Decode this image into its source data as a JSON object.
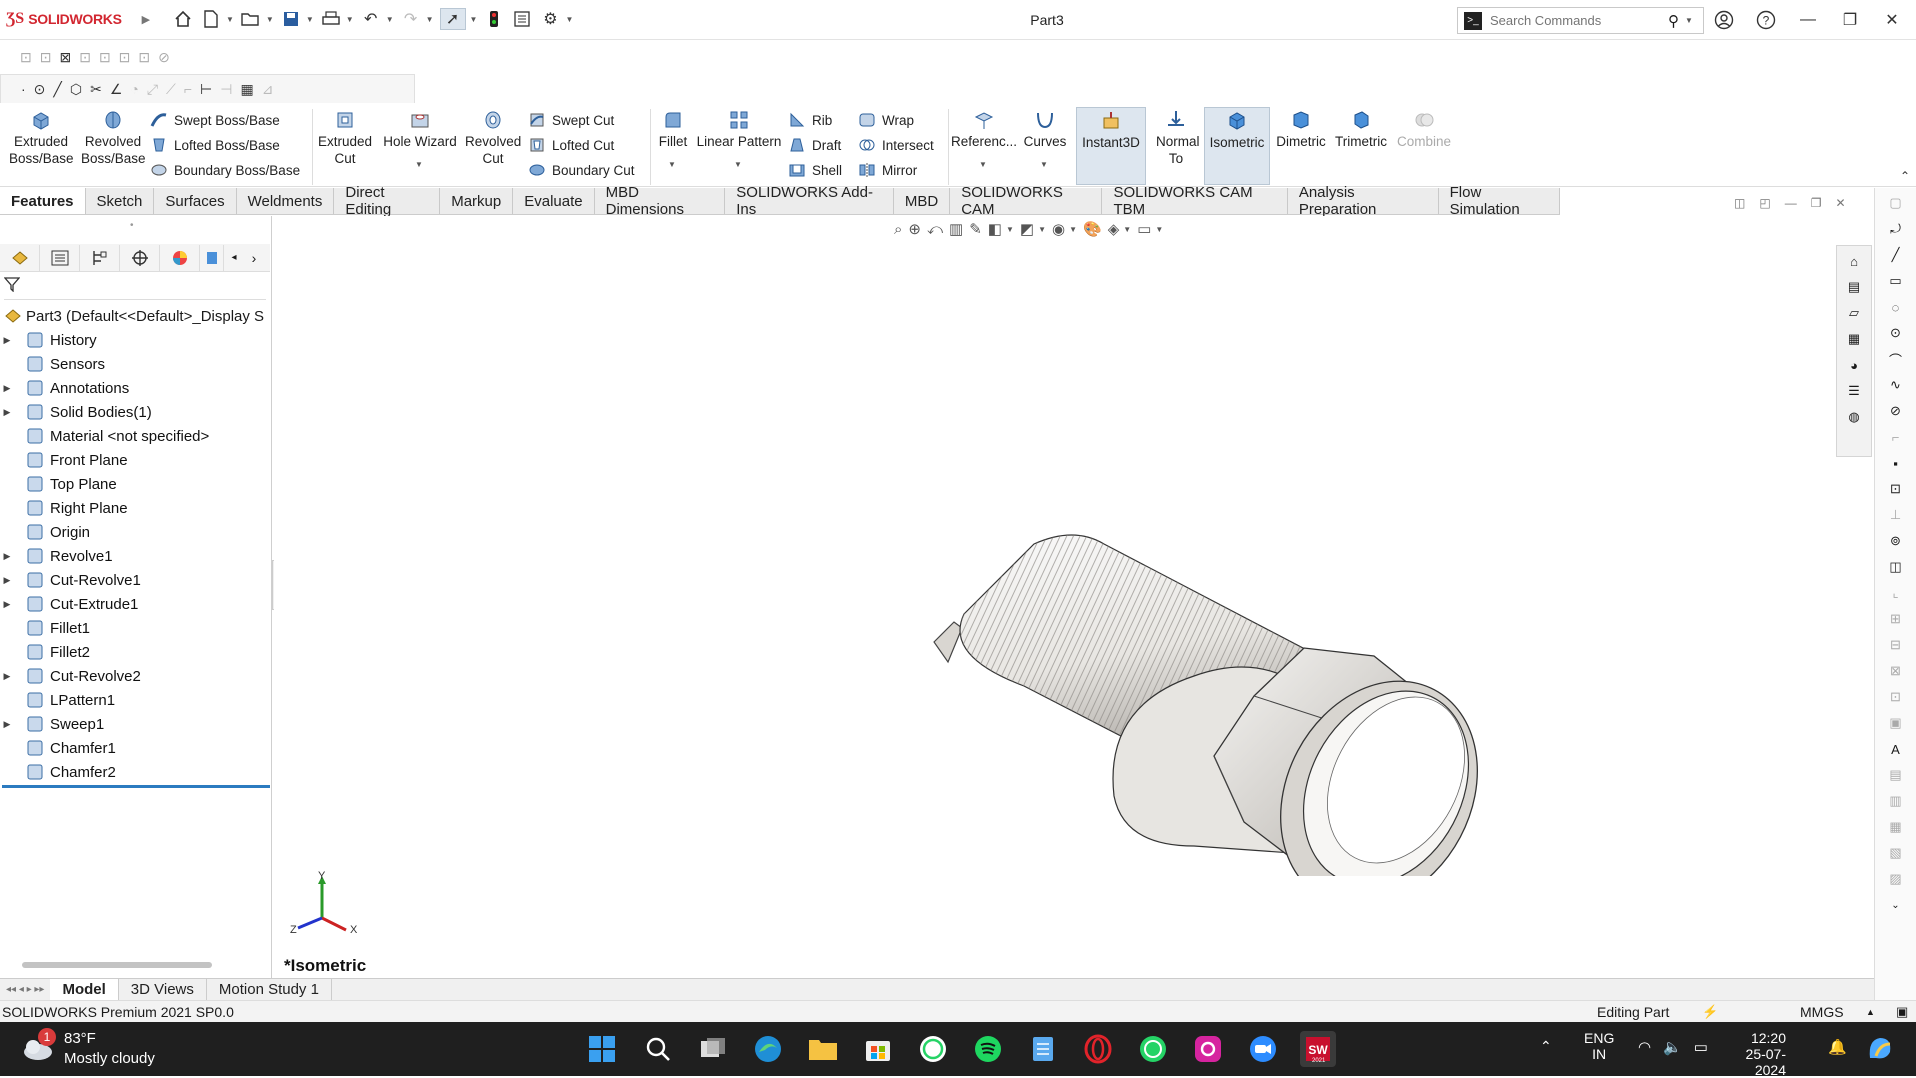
{
  "app": {
    "name": "SOLIDWORKS",
    "doc_title": "Part3"
  },
  "search": {
    "placeholder": "Search Commands"
  },
  "command_manager": {
    "extruded_boss": "Extruded Boss/Base",
    "revolved_boss": "Revolved Boss/Base",
    "swept_boss": "Swept Boss/Base",
    "lofted_boss": "Lofted Boss/Base",
    "boundary_boss": "Boundary Boss/Base",
    "extruded_cut": "Extruded Cut",
    "hole_wizard": "Hole Wizard",
    "revolved_cut": "Revolved Cut",
    "swept_cut": "Swept Cut",
    "lofted_cut": "Lofted Cut",
    "boundary_cut": "Boundary Cut",
    "fillet": "Fillet",
    "linear_pattern": "Linear Pattern",
    "rib": "Rib",
    "draft": "Draft",
    "shell": "Shell",
    "wrap": "Wrap",
    "intersect": "Intersect",
    "mirror": "Mirror",
    "reference": "Referenc...",
    "curves": "Curves",
    "instant3d": "Instant3D",
    "normal_to": "Normal To",
    "isometric": "Isometric",
    "dimetric": "Dimetric",
    "trimetric": "Trimetric",
    "combine": "Combine"
  },
  "tabs": [
    "Features",
    "Sketch",
    "Surfaces",
    "Weldments",
    "Direct Editing",
    "Markup",
    "Evaluate",
    "MBD Dimensions",
    "SOLIDWORKS Add-Ins",
    "MBD",
    "SOLIDWORKS CAM",
    "SOLIDWORKS CAM TBM",
    "Analysis Preparation",
    "Flow Simulation"
  ],
  "tree": {
    "root": "Part3  (Default<<Default>_Display S",
    "items": [
      {
        "label": "History",
        "icon": "history-icon",
        "expandable": true
      },
      {
        "label": "Sensors",
        "icon": "sensors-icon",
        "expandable": false
      },
      {
        "label": "Annotations",
        "icon": "annotations-icon",
        "expandable": true
      },
      {
        "label": "Solid Bodies(1)",
        "icon": "solid-bodies-icon",
        "expandable": true
      },
      {
        "label": "Material <not specified>",
        "icon": "material-icon",
        "expandable": false
      },
      {
        "label": "Front Plane",
        "icon": "plane-icon",
        "expandable": false
      },
      {
        "label": "Top Plane",
        "icon": "plane-icon",
        "expandable": false
      },
      {
        "label": "Right Plane",
        "icon": "plane-icon",
        "expandable": false
      },
      {
        "label": "Origin",
        "icon": "origin-icon",
        "expandable": false
      },
      {
        "label": "Revolve1",
        "icon": "revolve-icon",
        "expandable": true
      },
      {
        "label": "Cut-Revolve1",
        "icon": "cut-revolve-icon",
        "expandable": true
      },
      {
        "label": "Cut-Extrude1",
        "icon": "cut-extrude-icon",
        "expandable": true
      },
      {
        "label": "Fillet1",
        "icon": "fillet-icon",
        "expandable": false
      },
      {
        "label": "Fillet2",
        "icon": "fillet-icon",
        "expandable": false
      },
      {
        "label": "Cut-Revolve2",
        "icon": "cut-revolve-icon",
        "expandable": true
      },
      {
        "label": "LPattern1",
        "icon": "linear-pattern-icon",
        "expandable": false
      },
      {
        "label": "Sweep1",
        "icon": "sweep-icon",
        "expandable": true
      },
      {
        "label": "Chamfer1",
        "icon": "chamfer-icon",
        "expandable": false
      },
      {
        "label": "Chamfer2",
        "icon": "chamfer-icon",
        "expandable": false
      }
    ]
  },
  "viewport": {
    "view_label": "*Isometric",
    "triad": {
      "x": "X",
      "y": "Y",
      "z": "Z"
    }
  },
  "bottom_tabs": [
    "Model",
    "3D Views",
    "Motion Study 1"
  ],
  "status": {
    "left": "SOLIDWORKS Premium 2021 SP0.0",
    "mode": "Editing Part",
    "units": "MMGS"
  },
  "taskbar": {
    "weather_temp": "83°F",
    "weather_desc": "Mostly cloudy",
    "weather_badge": "1",
    "lang_1": "ENG",
    "lang_2": "IN",
    "time": "12:20",
    "date": "25-07-2024",
    "sw_badge": "2021"
  },
  "colors": {
    "accent": "#d22630",
    "selection_blue": "#2b7bc0",
    "taskbar": "#1f1f1f"
  }
}
